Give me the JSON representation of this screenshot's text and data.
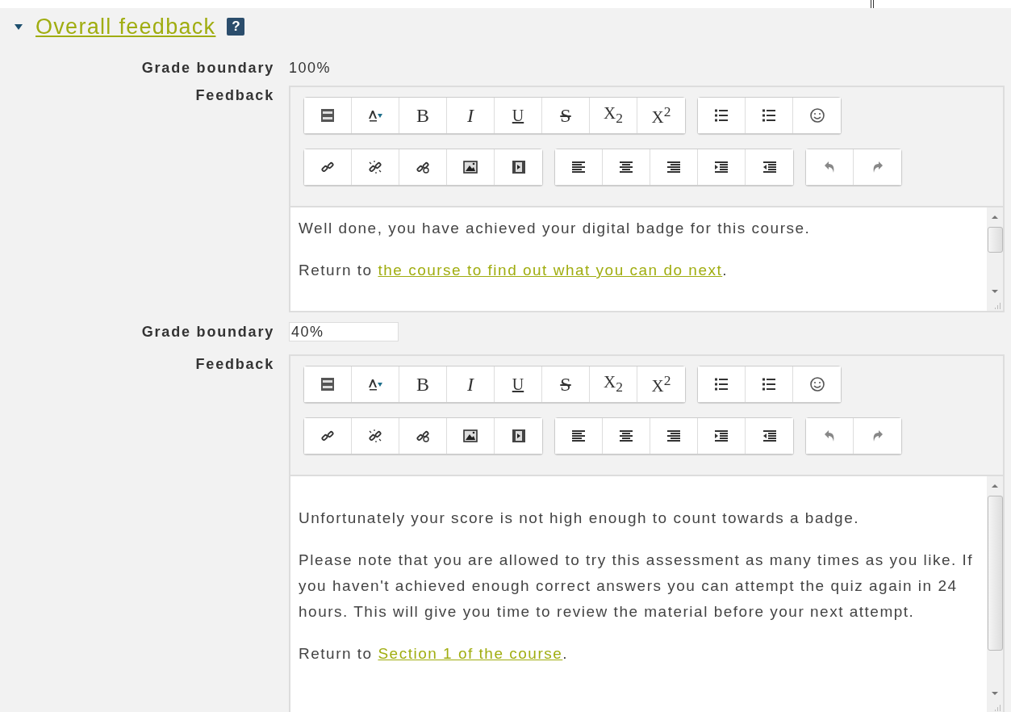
{
  "section": {
    "title": "Overall feedback",
    "expanded": true,
    "help": "?"
  },
  "entries": [
    {
      "grade_label": "Grade boundary",
      "grade": {
        "kind": "text",
        "value": "100%"
      },
      "feedback_label": "Feedback",
      "editor": {
        "glyphs": [
          "B",
          "I",
          "U",
          "S",
          "X$_{2}$",
          "X$^{2}$"
        ],
        "paragraphs": [
          {
            "text": "Well done, you have achieved your digital badge for this course."
          },
          {
            "text": "Return to ",
            "link": "the course to find out what you can do next",
            "after": "."
          }
        ]
      }
    },
    {
      "grade_label": "Grade boundary",
      "grade": {
        "kind": "field",
        "value": "40%"
      },
      "feedback_label": "Feedback",
      "editor": {
        "glyphs": [
          "B",
          "I",
          "U",
          "S",
          "X$_{2}$",
          "X$^{2}$"
        ],
        "paragraphs": [
          {
            "text": "Unfortunately your score is not high enough to count towards a badge."
          },
          {
            "text": "Please note that you are allowed to try this assessment as many times as you like. If you haven't achieved enough correct answers you can attempt the quiz again in 24 hours. This will give you time to review the material before your next attempt."
          },
          {
            "text": "Return to ",
            "link": "Section 1 of the course",
            "after": "."
          }
        ]
      }
    }
  ]
}
